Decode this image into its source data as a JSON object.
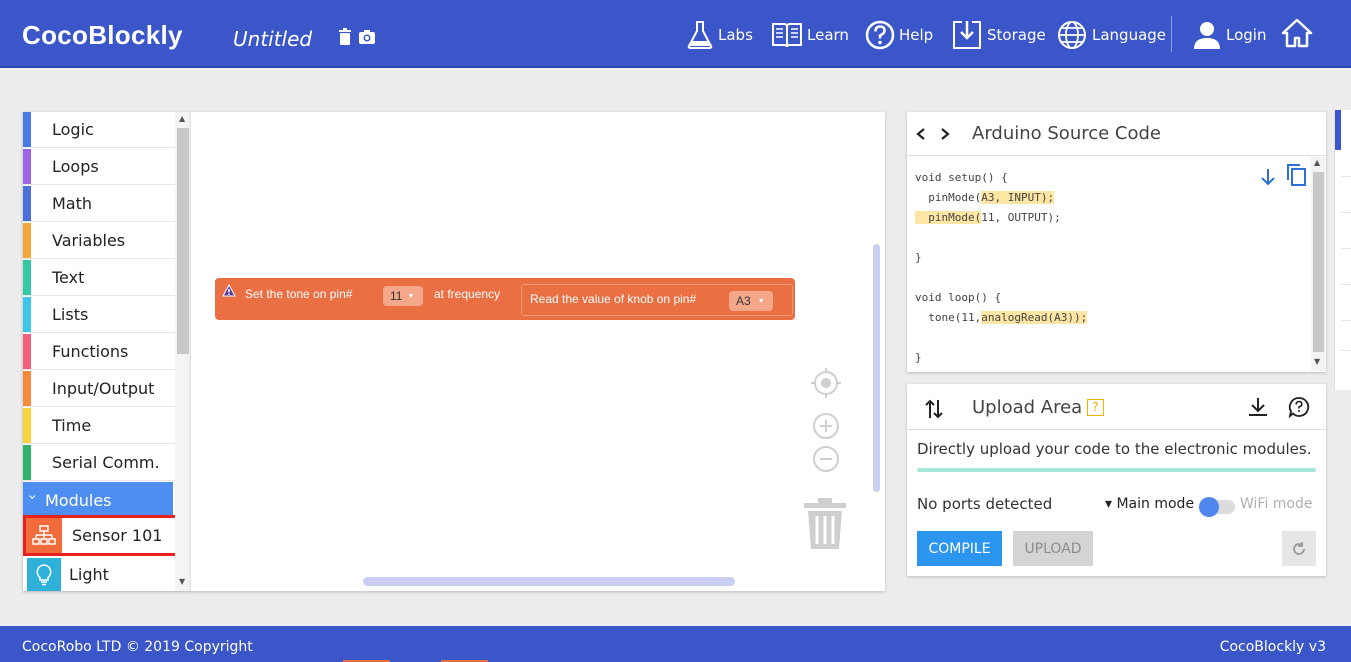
{
  "header": {
    "brand": "CocoBlockly",
    "doc_title": "Untitled",
    "nav": {
      "labs": "Labs",
      "learn": "Learn",
      "help": "Help",
      "storage": "Storage",
      "language": "Language",
      "login": "Login"
    }
  },
  "toolbox": {
    "categories": [
      {
        "label": "Logic",
        "color": "#4a7be4"
      },
      {
        "label": "Loops",
        "color": "#9b65e6"
      },
      {
        "label": "Math",
        "color": "#4a6fd6"
      },
      {
        "label": "Variables",
        "color": "#f5a83a"
      },
      {
        "label": "Text",
        "color": "#35c8a4"
      },
      {
        "label": "Lists",
        "color": "#3ec5e8"
      },
      {
        "label": "Functions",
        "color": "#f25f7a"
      },
      {
        "label": "Input/Output",
        "color": "#f58a3c"
      },
      {
        "label": "Time",
        "color": "#f9d33c"
      },
      {
        "label": "Serial Comm.",
        "color": "#2fb36a"
      }
    ],
    "modules_label": "Modules",
    "modules_chevron": "›",
    "sensor_label": "Sensor 101",
    "light_label": "Light"
  },
  "workspace": {
    "block": {
      "prefix": "Set the tone on pin#",
      "pin_value": "11",
      "freq_label": "at frequency",
      "inner_label": "Read the value of knob on pin#",
      "inner_pin": "A3",
      "warning_icon": "warning-triangle-icon"
    }
  },
  "code_panel": {
    "title": "Arduino Source Code",
    "code": {
      "l1": "void setup() {",
      "l2a": "  pinMode(",
      "l2b": "A3, INPUT);",
      "l3a": "  pinMode(",
      "l3b": "11, OUTPUT);",
      "l5": "}",
      "l7": "void loop() {",
      "l8a": "  tone(11,",
      "l8b": "analogRead(A3));",
      "l10": "}"
    }
  },
  "upload_panel": {
    "title": "Upload Area",
    "help_badge": "?",
    "description": "Directly upload your code to the electronic modules.",
    "ports_text": "No ports detected",
    "main_mode": "▾ Main mode",
    "wifi_mode": "WiFi mode",
    "compile_label": "COMPILE",
    "upload_label": "UPLOAD"
  },
  "footer": {
    "copyright": "CocoRobo LTD © 2019 Copyright",
    "version": "CocoBlockly v3"
  },
  "colors": {
    "header_blue": "#3a56c9",
    "block_orange": "#ea6f43",
    "compile_blue": "#2b95f0",
    "highlight": "#fde6a3"
  }
}
